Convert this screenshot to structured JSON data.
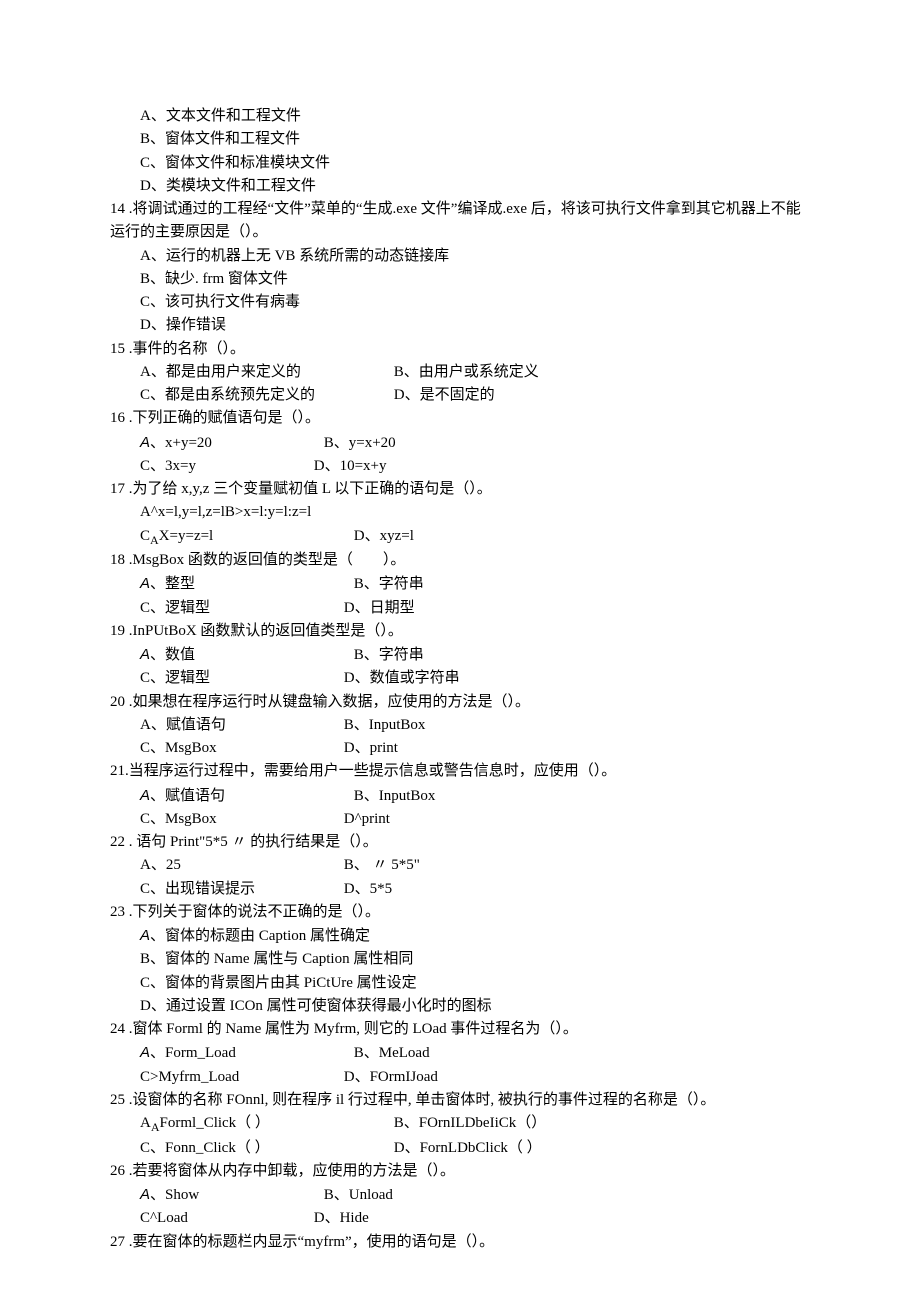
{
  "q13": {
    "A": "A、文本文件和工程文件",
    "B": "B、窗体文件和工程文件",
    "C": "C、窗体文件和标准模块文件",
    "D": "D、类模块文件和工程文件"
  },
  "q14": {
    "stem": "14  .将调试通过的工程经“文件”菜单的“生成.exe 文件”编译成.exe 后，将该可执行文件拿到其它机器上不能运行的主要原因是（）。",
    "A": "A、运行的机器上无 VB 系统所需的动态链接库",
    "B": "B、缺少. frm 窗体文件",
    "C": "C、该可执行文件有病毒",
    "D": "D、操作错误"
  },
  "q15": {
    "stem": "15  .事件的名称（）。",
    "A": "A、都是由用户来定义的",
    "B": "B、由用户或系统定义",
    "C": "C、都是由系统预先定义的",
    "D": "D、是不固定的"
  },
  "q16": {
    "stem": "16  .下列正确的赋值语句是（）。",
    "Apre": "A",
    "Apost": "、x+y=20",
    "B": "B、y=x+20",
    "C": "C、3x=y",
    "D": "D、10=x+y"
  },
  "q17": {
    "stem": "17  .为了给 x,y,z 三个变量赋初值 L 以下正确的语句是（）。",
    "A": "A^x=l,y=l,z=lB>x=l:y=l:z=l",
    "Cpre": "C",
    "Csub": "A",
    "Cpost": "X=y=z=l",
    "D": "D、xyz=l"
  },
  "q18": {
    "stem": "18  .MsgBox 函数的返回值的类型是（　　）。",
    "Apre": "A",
    "Apost": "、整型",
    "B": "B、字符串",
    "C": "C、逻辑型",
    "D": "D、日期型"
  },
  "q19": {
    "stem": "19  .InPUtBoX 函数默认的返回值类型是（）。",
    "Apre": "A",
    "Apost": "、数值",
    "B": "B、字符串",
    "C": "C、逻辑型",
    "D": "D、数值或字符串"
  },
  "q20": {
    "stem": "20  .如果想在程序运行时从键盘输入数据，应使用的方法是（）。",
    "A": "A、赋值语句",
    "B": "B、InputBox",
    "C": "C、MsgBox",
    "D": "D、print"
  },
  "q21": {
    "stem": "21.当程序运行过程中，需要给用户一些提示信息或警告信息时，应使用（）。",
    "Apre": "A",
    "Apost": "、赋值语句",
    "B": "B、InputBox",
    "C": "C、MsgBox",
    "D": "D^print"
  },
  "q22": {
    "stem": "22  . 语句 Print\"5*5 〃 的执行结果是（）。",
    "A": "A、25",
    "B": "B、 〃 5*5\"",
    "C": "C、出现错误提示",
    "D": "D、5*5"
  },
  "q23": {
    "stem": "23  .下列关于窗体的说法不正确的是（）。",
    "Apre": "A",
    "Apost": "、窗体的标题由 Caption 属性确定",
    "B": "B、窗体的 Name 属性与 Caption 属性相同",
    "C": "C、窗体的背景图片由其 PiCtUre 属性设定",
    "D": "D、通过设置 ICOn 属性可使窗体获得最小化时的图标"
  },
  "q24": {
    "stem": "24  .窗体 Forml 的 Name 属性为 Myfrm, 则它的 LOad 事件过程名为（）。",
    "Apre": "A",
    "Apost": "、Form_Load",
    "B": "B、MeLoad",
    "C": "C>Myfrm_Load",
    "D": "D、FOrmIJoad"
  },
  "q25": {
    "stem": "25  .设窗体的名称 FOnnl, 则在程序 il 行过程中, 单击窗体时, 被执行的事件过程的名称是（）。",
    "Apre": "A",
    "Asub": "A",
    "Apost": "Forml_Click（ ）",
    "B": "B、FOrnILDbeIiCk（）",
    "C": "C、Fonn_Click（ ）",
    "D": "D、FornLDbClick（ ）"
  },
  "q26": {
    "stem": "26  .若要将窗体从内存中卸载，应使用的方法是（）。",
    "Apre": "A",
    "Apost": "、Show",
    "B": "B、Unload",
    "C": "C^Load",
    "D": "D、Hide"
  },
  "q27": {
    "stem": "27  .要在窗体的标题栏内显示“myfrm”，使用的语句是（）。"
  }
}
